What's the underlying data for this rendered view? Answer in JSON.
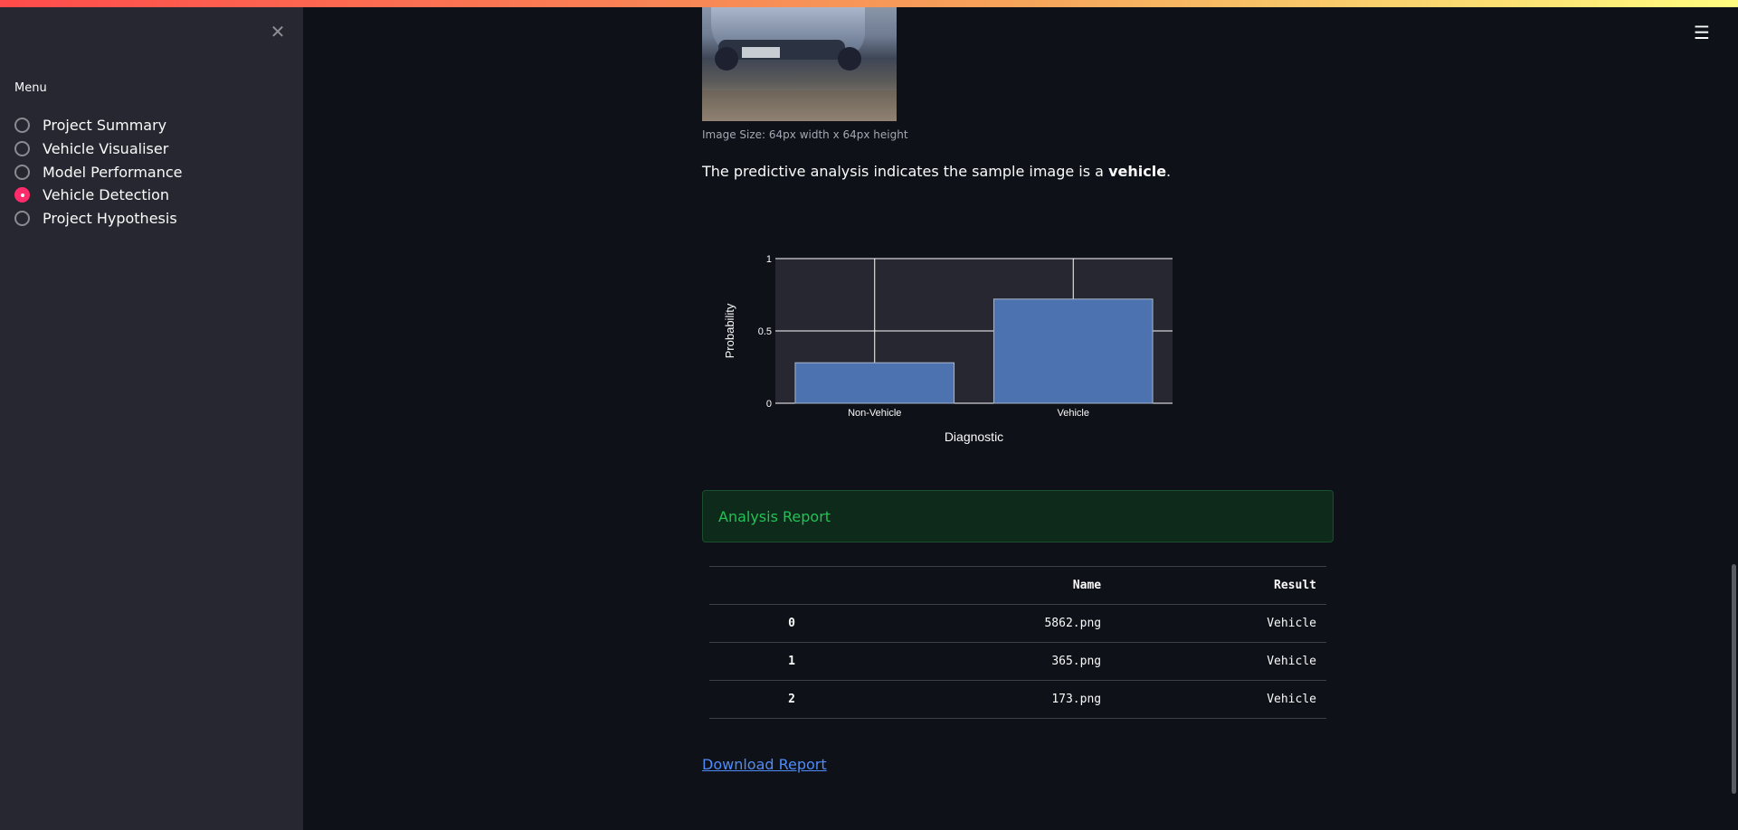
{
  "sidebar": {
    "menu_label": "Menu",
    "items": [
      {
        "label": "Project Summary",
        "selected": false
      },
      {
        "label": "Vehicle Visualiser",
        "selected": false
      },
      {
        "label": "Model Performance",
        "selected": false
      },
      {
        "label": "Vehicle Detection",
        "selected": true
      },
      {
        "label": "Project Hypothesis",
        "selected": false
      }
    ],
    "close_icon": "close-icon"
  },
  "header": {
    "menu_icon": "hamburger-icon"
  },
  "main": {
    "image_caption": "Image Size: 64px width x 64px height",
    "prediction_prefix": "The predictive analysis indicates the sample image is a ",
    "prediction_class": "vehicle",
    "prediction_suffix": ".",
    "report_title": "Analysis Report",
    "table": {
      "columns": [
        "",
        "Name",
        "Result"
      ],
      "rows": [
        [
          "0",
          "5862.png",
          "Vehicle"
        ],
        [
          "1",
          "365.png",
          "Vehicle"
        ],
        [
          "2",
          "173.png",
          "Vehicle"
        ]
      ]
    },
    "download_label": "Download Report"
  },
  "chart_data": {
    "type": "bar",
    "categories": [
      "Non-Vehicle",
      "Vehicle"
    ],
    "values": [
      0.28,
      0.72
    ],
    "xlabel": "Diagnostic",
    "ylabel": "Probability",
    "ylim": [
      0,
      1
    ],
    "yticks": [
      "0",
      "0.5",
      "1"
    ],
    "grid": true,
    "bar_color": "#4c72b0",
    "plot_bg": "#262730"
  },
  "colors": {
    "accent": "#ff2b6a",
    "success_bg": "#0d2a1a",
    "success_text": "#21c354",
    "link": "#4f8bf9"
  }
}
